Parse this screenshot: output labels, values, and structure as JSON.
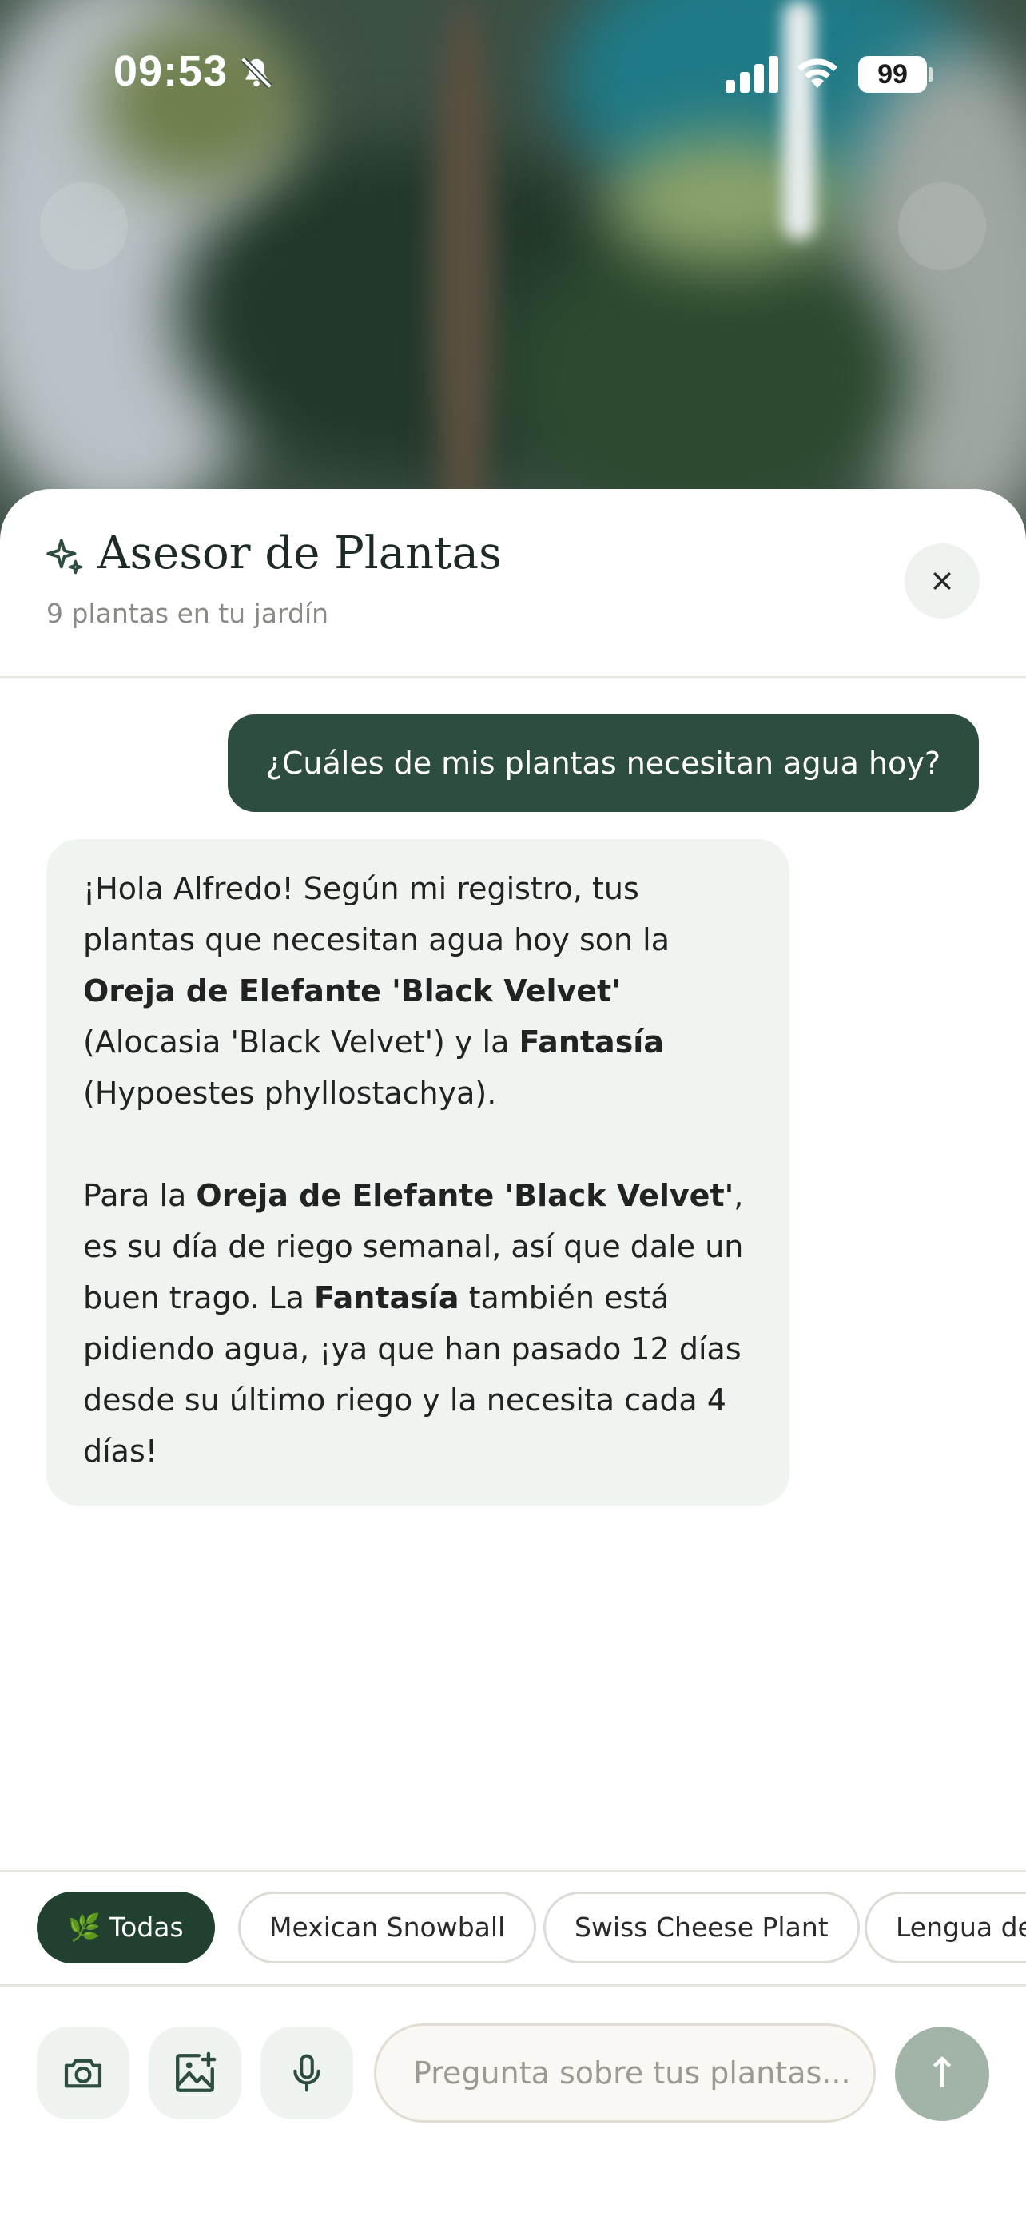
{
  "status_bar": {
    "time": "09:53",
    "battery": "99"
  },
  "header": {
    "title": "Asesor de Plantas",
    "subtitle": "9 plantas en tu jardín"
  },
  "conversation": {
    "user_message": "¿Cuáles de mis plantas necesitan agua hoy?",
    "assistant_paragraph_1": [
      "¡Hola Alfredo! Según mi registro, tus plantas que necesitan agua hoy son la ",
      "Oreja de Elefante 'Black Velvet'",
      " (Alocasia 'Black Velvet') y la ",
      "Fantasía",
      " (Hypoestes phyllostachya)."
    ],
    "assistant_paragraph_2": [
      "Para la ",
      "Oreja de Elefante 'Black Velvet'",
      ", es su día de riego semanal, así que dale un buen trago. La ",
      "Fantasía",
      " también está pidiendo agua, ¡ya que han pasado 12 días desde su último riego y la necesita cada 4 días!"
    ]
  },
  "filter_chips": [
    {
      "label": "🌿 Todas",
      "active": true
    },
    {
      "label": "Mexican Snowball",
      "active": false
    },
    {
      "label": "Swiss Cheese Plant",
      "active": false
    },
    {
      "label": "Lengua de",
      "active": false
    }
  ],
  "composer": {
    "placeholder": "Pregunta sobre tus plantas...",
    "send_arrow": "↑",
    "icons": [
      "camera-icon",
      "add-image-icon",
      "microphone-icon"
    ]
  },
  "colors": {
    "accent_dark_green": "#2d4d3e",
    "chip_active": "#22402f",
    "send_disabled": "#a2b3a8",
    "assistant_bubble": "#f0f4f0"
  }
}
